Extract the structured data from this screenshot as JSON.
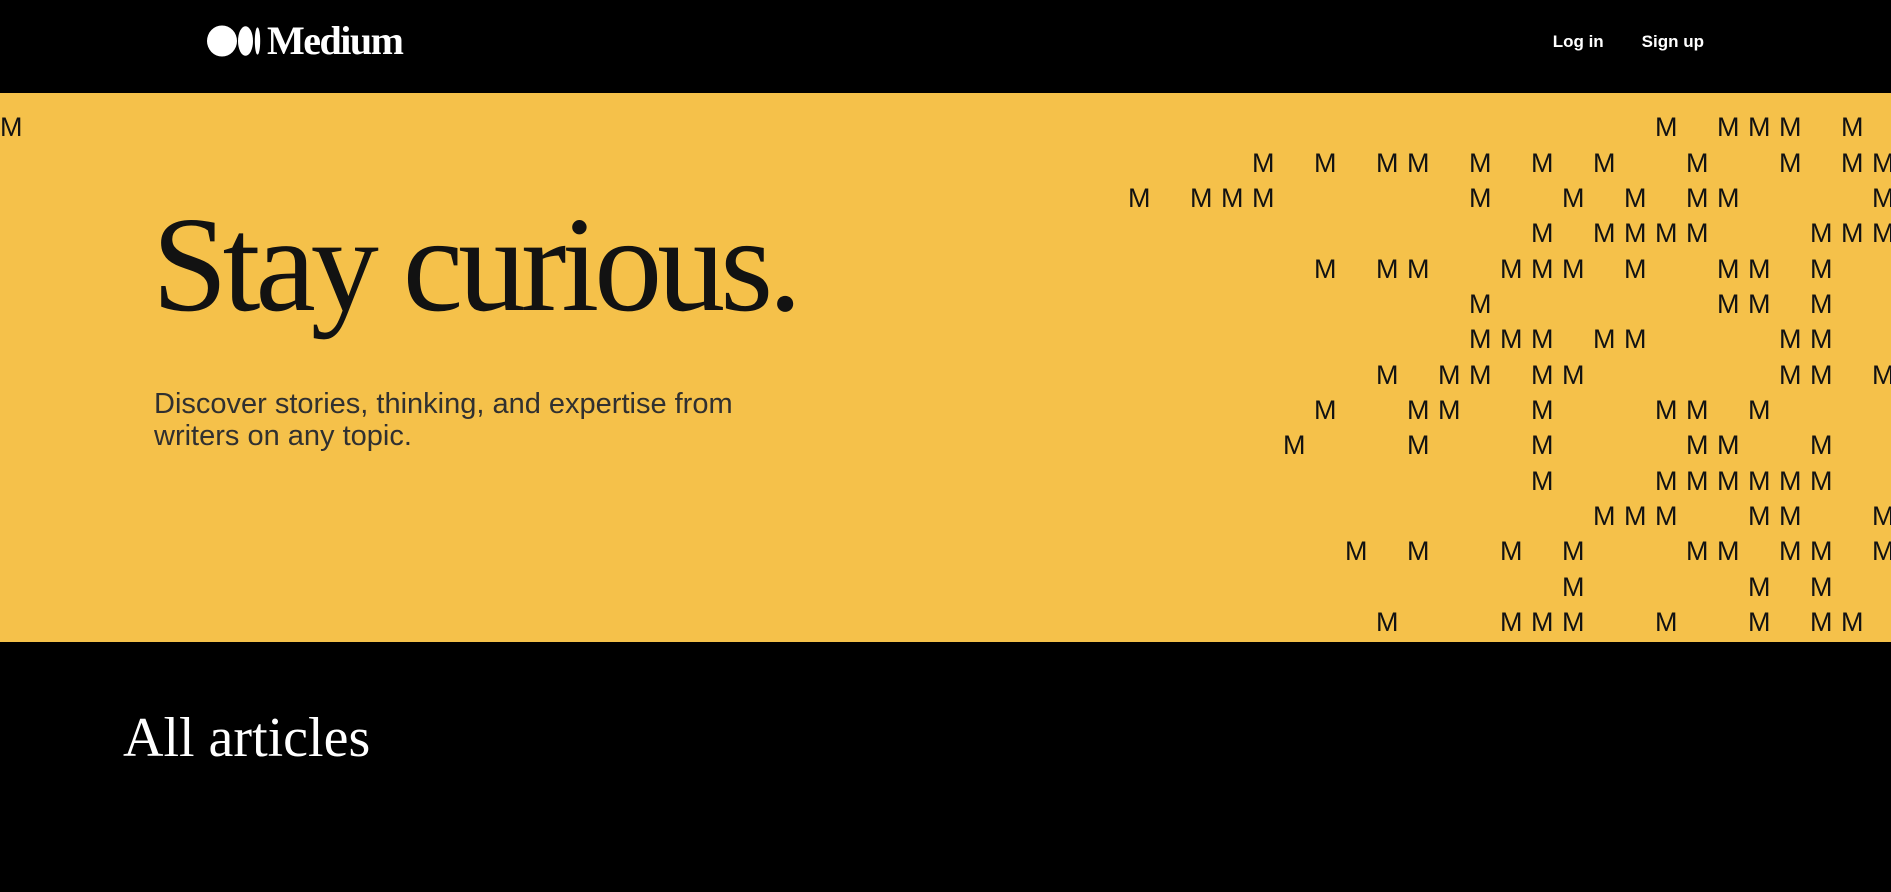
{
  "header": {
    "logo_text": "Medium",
    "nav": {
      "login_label": "Log in",
      "signup_label": "Sign up"
    }
  },
  "hero": {
    "title": "Stay curious.",
    "subtitle": "Discover stories, thinking, and expertise from writers on any topic.",
    "pattern_glyph": "M"
  },
  "section": {
    "title": "All articles"
  },
  "colors": {
    "page_background": "#000000",
    "hero_background": "#F5C14A",
    "hero_text": "#121212",
    "header_text": "#FFFFFF"
  }
}
